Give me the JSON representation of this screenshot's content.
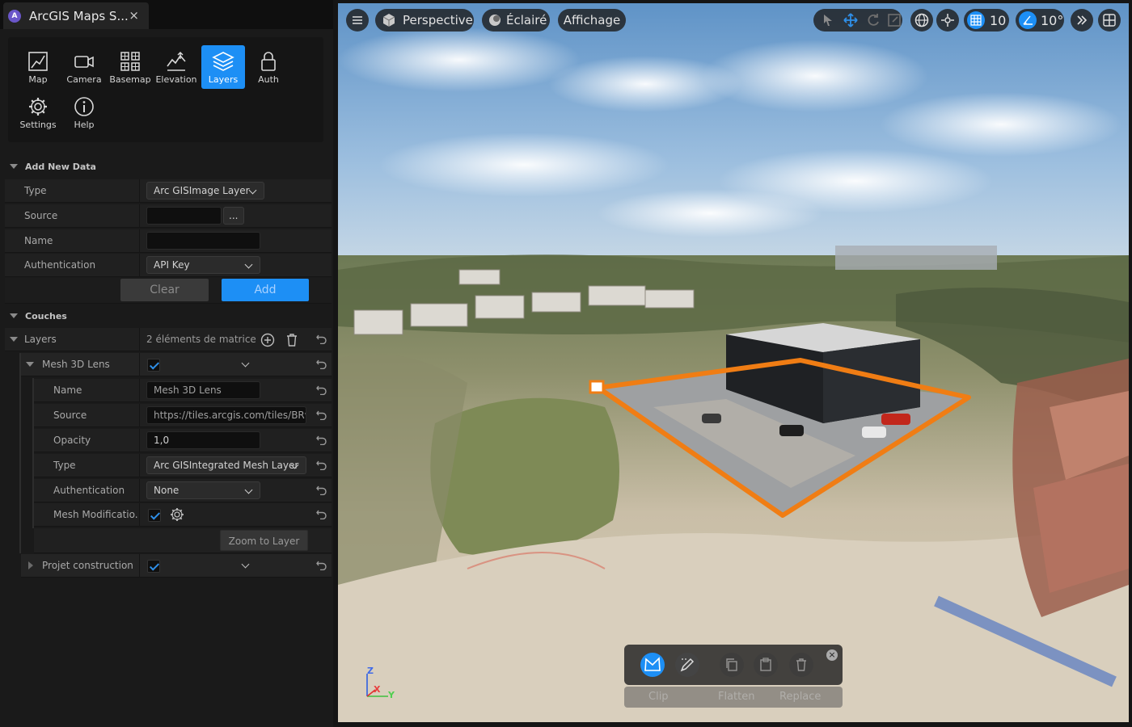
{
  "tab": {
    "title": "ArcGIS Maps S...",
    "close": "×"
  },
  "tools": [
    {
      "label": "Map",
      "icon": "map-icon"
    },
    {
      "label": "Camera",
      "icon": "camera-icon"
    },
    {
      "label": "Basemap",
      "icon": "basemap-icon"
    },
    {
      "label": "Elevation",
      "icon": "elevation-icon"
    },
    {
      "label": "Layers",
      "icon": "layers-icon",
      "active": true
    },
    {
      "label": "Auth",
      "icon": "lock-icon"
    },
    {
      "label": "Settings",
      "icon": "gear-icon"
    },
    {
      "label": "Help",
      "icon": "info-icon"
    }
  ],
  "add_new_data": {
    "header": "Add New Data",
    "type_label": "Type",
    "type_value": "Arc GISImage Layer",
    "source_label": "Source",
    "source_value": "",
    "browse": "...",
    "name_label": "Name",
    "name_value": "",
    "auth_label": "Authentication",
    "auth_value": "API Key",
    "clear": "Clear",
    "add": "Add"
  },
  "couches": {
    "header": "Couches",
    "layers_label": "Layers",
    "layers_count": "2 éléments de matrice",
    "mesh": {
      "label": "Mesh 3D Lens",
      "name_label": "Name",
      "name_value": "Mesh 3D Lens",
      "source_label": "Source",
      "source_value": "https://tiles.arcgis.com/tiles/BRw",
      "opacity_label": "Opacity",
      "opacity_value": "1,0",
      "type_label": "Type",
      "type_value": "Arc GISIntegrated Mesh Layer",
      "auth_label": "Authentication",
      "auth_value": "None",
      "modif_label": "Mesh Modificatio...",
      "zoom": "Zoom to Layer"
    },
    "project": {
      "label": "Projet construction"
    }
  },
  "viewport": {
    "perspective": "Perspective",
    "lit": "Éclairé",
    "show": "Affichage",
    "grid_value": "10",
    "angle_value": "10°",
    "bottom_labels": {
      "clip": "Clip",
      "flatten": "Flatten",
      "replace": "Replace"
    },
    "axes": {
      "z": "Z",
      "x": "X",
      "y": "Y"
    }
  },
  "colors": {
    "accent": "#1d8ff5",
    "outline": "#f07d14",
    "panel": "#1a1a1a"
  }
}
